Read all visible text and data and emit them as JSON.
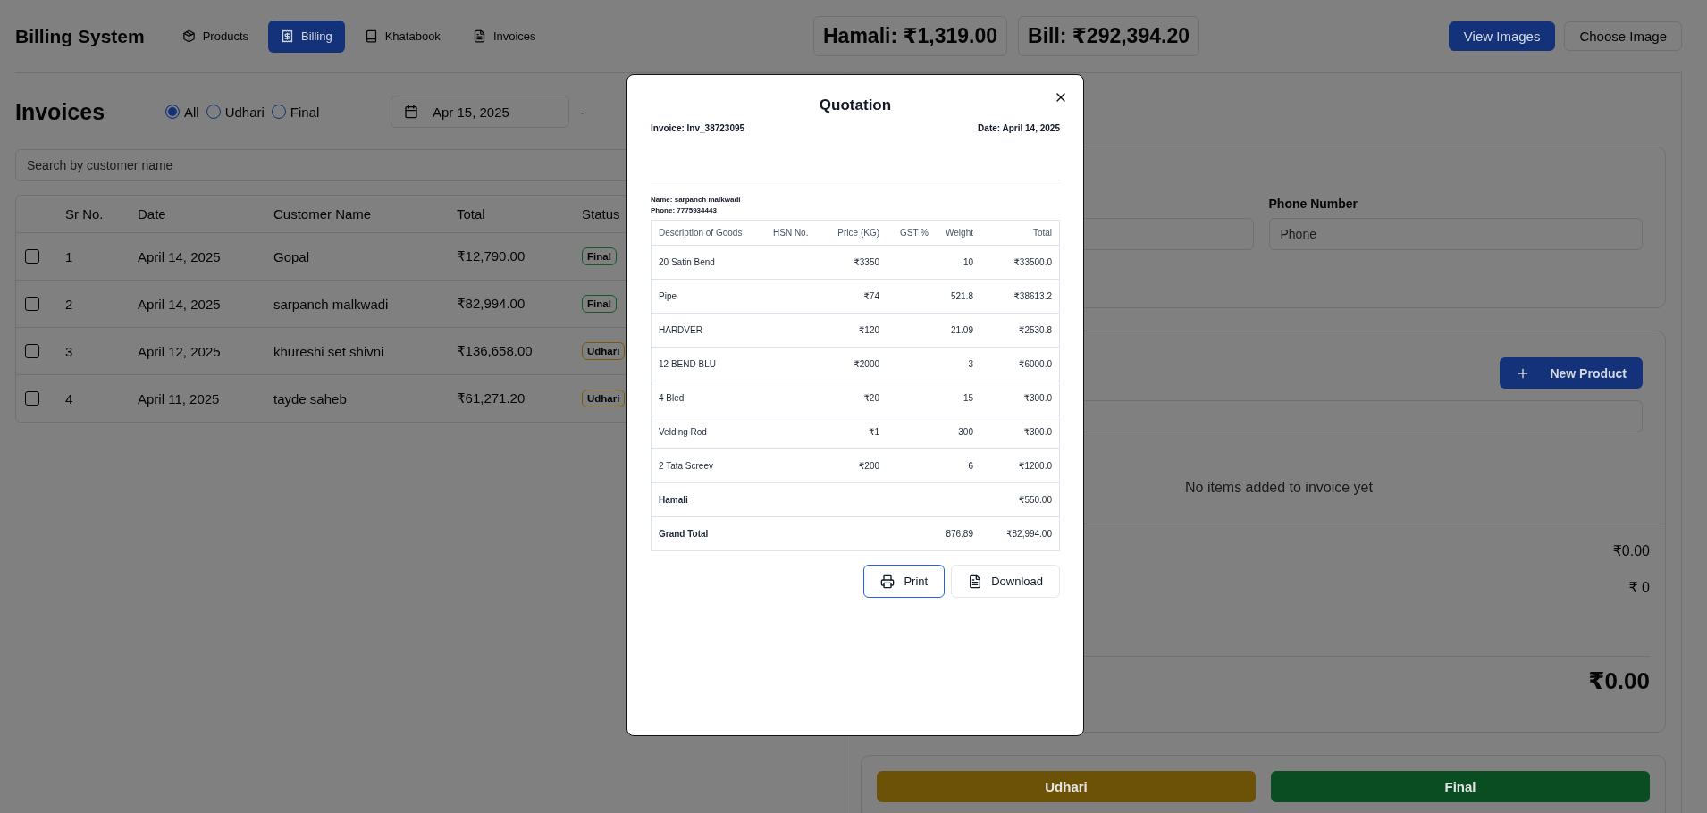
{
  "header": {
    "title": "Billing System",
    "nav": [
      {
        "label": "Products",
        "selected": false
      },
      {
        "label": "Billing",
        "selected": true
      },
      {
        "label": "Khatabook",
        "selected": false
      },
      {
        "label": "Invoices",
        "selected": false
      }
    ],
    "stats": [
      "Hamali: ₹1,319.00",
      "Bill: ₹292,394.20"
    ],
    "buttons": [
      {
        "label": "View Images",
        "kind": "primary"
      },
      {
        "label": "Choose Image",
        "kind": "outline"
      }
    ]
  },
  "invoices": {
    "title": "Invoices",
    "filters": [
      {
        "label": "All",
        "selected": true
      },
      {
        "label": "Udhari",
        "selected": false
      },
      {
        "label": "Final",
        "selected": false
      }
    ],
    "date_from": "Apr 15, 2025",
    "date_separator": "-",
    "search": {
      "placeholder": "Search by customer name"
    },
    "columns": [
      "Sr No.",
      "Date",
      "Customer Name",
      "Total",
      "Status"
    ],
    "rows": [
      {
        "checked": false,
        "sr": "1",
        "date": "April 14, 2025",
        "customer": "Gopal",
        "total": "₹12,790.00",
        "status": {
          "label": "Final",
          "color": "#0f5c2a"
        }
      },
      {
        "checked": false,
        "sr": "2",
        "date": "April 14, 2025",
        "customer": "sarpanch malkwadi",
        "total": "₹82,994.00",
        "status": {
          "label": "Final",
          "color": "#0f5c2a"
        }
      },
      {
        "checked": false,
        "sr": "3",
        "date": "April 12, 2025",
        "customer": "khureshi set shivni",
        "total": "₹136,658.00",
        "status": {
          "label": "Udhari",
          "color": "#7a5a05"
        }
      },
      {
        "checked": false,
        "sr": "4",
        "date": "April 11, 2025",
        "customer": "tayde saheb",
        "total": "₹61,271.20",
        "status": {
          "label": "Udhari",
          "color": "#7a5a05"
        }
      }
    ]
  },
  "customer": {
    "phone_label": "Phone Number",
    "phone_placeholder": "Phone"
  },
  "products": {
    "new_button": "New Product",
    "empty_message": "No items added to invoice yet",
    "summary": [
      "₹0.00",
      "₹ 0"
    ],
    "total": "₹0.00"
  },
  "actions": [
    {
      "label": "Udhari",
      "kind": "udhari"
    },
    {
      "label": "Final",
      "kind": "final"
    }
  ],
  "modal": {
    "title": "Quotation",
    "invoice": "Invoice: Inv_38723095",
    "date": "Date: April 14, 2025",
    "name": "Name: sarpanch malkwadi",
    "phone": "Phone: 7775934443",
    "columns": [
      "Description of Goods",
      "HSN No.",
      "Price (KG)",
      "GST %",
      "Weight",
      "Total"
    ],
    "items": [
      {
        "description": "20 Satin Bend",
        "price": "₹3350",
        "weight": "10",
        "total": "₹33500.0"
      },
      {
        "description": "Pipe",
        "price": "₹74",
        "weight": "521.8",
        "total": "₹38613.2"
      },
      {
        "description": "HARDVER",
        "price": "₹120",
        "weight": "21.09",
        "total": "₹2530.8"
      },
      {
        "description": "12 BEND BLU",
        "price": "₹2000",
        "weight": "3",
        "total": "₹6000.0"
      },
      {
        "description": "4 Bled",
        "price": "₹20",
        "weight": "15",
        "total": "₹300.0"
      },
      {
        "description": "Velding Rod",
        "price": "₹1",
        "weight": "300",
        "total": "₹300.0"
      },
      {
        "description": "2 Tata Screev",
        "price": "₹200",
        "weight": "6",
        "total": "₹1200.0"
      }
    ],
    "hamali": {
      "label": "Hamali",
      "total": "₹550.00"
    },
    "grand_total": {
      "label": "Grand Total",
      "weight": "876.89",
      "total": "₹82,994.00"
    },
    "buttons": [
      {
        "label": "Print",
        "focused": true
      },
      {
        "label": "Download",
        "focused": false
      }
    ]
  }
}
